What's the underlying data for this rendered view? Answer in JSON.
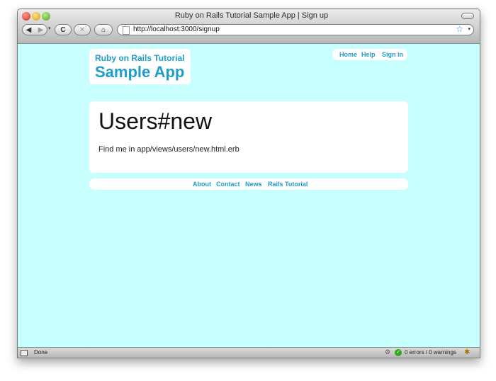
{
  "window": {
    "title": "Ruby on Rails Tutorial Sample App | Sign up"
  },
  "toolbar": {
    "back_icon": "◀",
    "forward_icon": "▶",
    "history_dropdown": "▾",
    "reload_icon": "C",
    "stop_icon": "✕",
    "home_icon": "⌂",
    "url": "http://localhost:3000/signup",
    "bookmark_icon": "☆",
    "bookmark_dropdown": "▾"
  },
  "header": {
    "logo_subtitle": "Ruby on Rails Tutorial",
    "logo_title": "Sample App",
    "nav": [
      {
        "label": "Home"
      },
      {
        "label": "Help"
      },
      {
        "label": "Sign in"
      }
    ]
  },
  "main": {
    "heading": "Users#new",
    "text": "Find me in app/views/users/new.html.erb"
  },
  "footer": {
    "links": [
      {
        "label": "About"
      },
      {
        "label": "Contact"
      },
      {
        "label": "News"
      },
      {
        "label": "Rails Tutorial"
      }
    ]
  },
  "statusbar": {
    "status": "Done",
    "validation": "0 errors / 0 warnings",
    "check_icon": "✓",
    "cog_icon": "⚙",
    "extension_icon": "✱"
  },
  "colors": {
    "page_background": "#c8ffff",
    "link": "#1e9ecb"
  }
}
